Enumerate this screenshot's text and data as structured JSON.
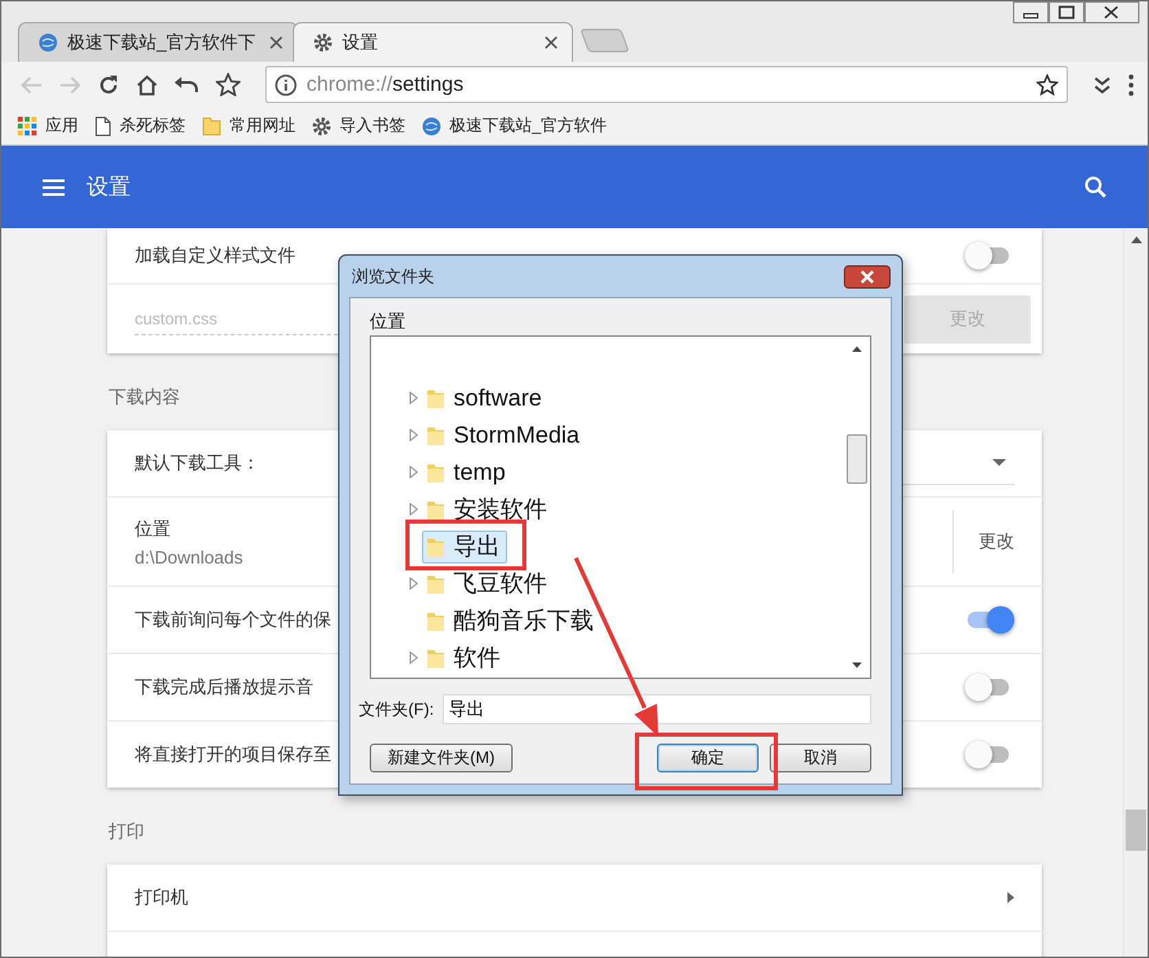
{
  "tabs": [
    {
      "title": "极速下载站_官方软件下",
      "selected": false
    },
    {
      "title": "设置",
      "selected": true
    }
  ],
  "address_bar": {
    "scheme": "chrome://",
    "path": "settings"
  },
  "bookmarks": [
    {
      "label": "应用"
    },
    {
      "label": "杀死标签"
    },
    {
      "label": "常用网址"
    },
    {
      "label": "导入书签"
    },
    {
      "label": "极速下载站_官方软件"
    }
  ],
  "header": {
    "title": "设置"
  },
  "sections": [
    {
      "rows": [
        {
          "kind": "toggle",
          "label": "加载自定义样式文件",
          "on": false
        },
        {
          "kind": "input",
          "placeholder": "custom.css",
          "button": "更改",
          "disabled": true
        }
      ]
    },
    {
      "title": "下载内容",
      "rows": [
        {
          "kind": "select",
          "label": "默认下载工具："
        },
        {
          "kind": "path",
          "label": "位置",
          "value": "d:\\Downloads",
          "button": "更改"
        },
        {
          "kind": "toggle",
          "label": "下载前询问每个文件的保",
          "on": true
        },
        {
          "kind": "toggle",
          "label": "下载完成后播放提示音",
          "on": false
        },
        {
          "kind": "toggle",
          "label": "将直接打开的项目保存至",
          "on": false
        }
      ]
    },
    {
      "title": "打印",
      "rows": [
        {
          "kind": "link",
          "label": "打印机"
        }
      ]
    }
  ],
  "dialog": {
    "title": "浏览文件夹",
    "location_label": "位置",
    "tree": [
      {
        "label": "software",
        "has_children": true,
        "selected": false
      },
      {
        "label": "StormMedia",
        "has_children": true,
        "selected": false
      },
      {
        "label": "temp",
        "has_children": true,
        "selected": false
      },
      {
        "label": "安装软件",
        "has_children": true,
        "selected": false
      },
      {
        "label": "导出",
        "has_children": false,
        "selected": true
      },
      {
        "label": "飞豆软件",
        "has_children": true,
        "selected": false
      },
      {
        "label": "酷狗音乐下载",
        "has_children": false,
        "selected": false
      },
      {
        "label": "软件",
        "has_children": true,
        "selected": false
      }
    ],
    "folder_label": "文件夹(F):",
    "folder_value": "导出",
    "buttons": [
      {
        "label": "新建文件夹(M)",
        "kind": "new"
      },
      {
        "label": "确定",
        "kind": "default"
      },
      {
        "label": "取消",
        "kind": "cancel"
      }
    ]
  }
}
